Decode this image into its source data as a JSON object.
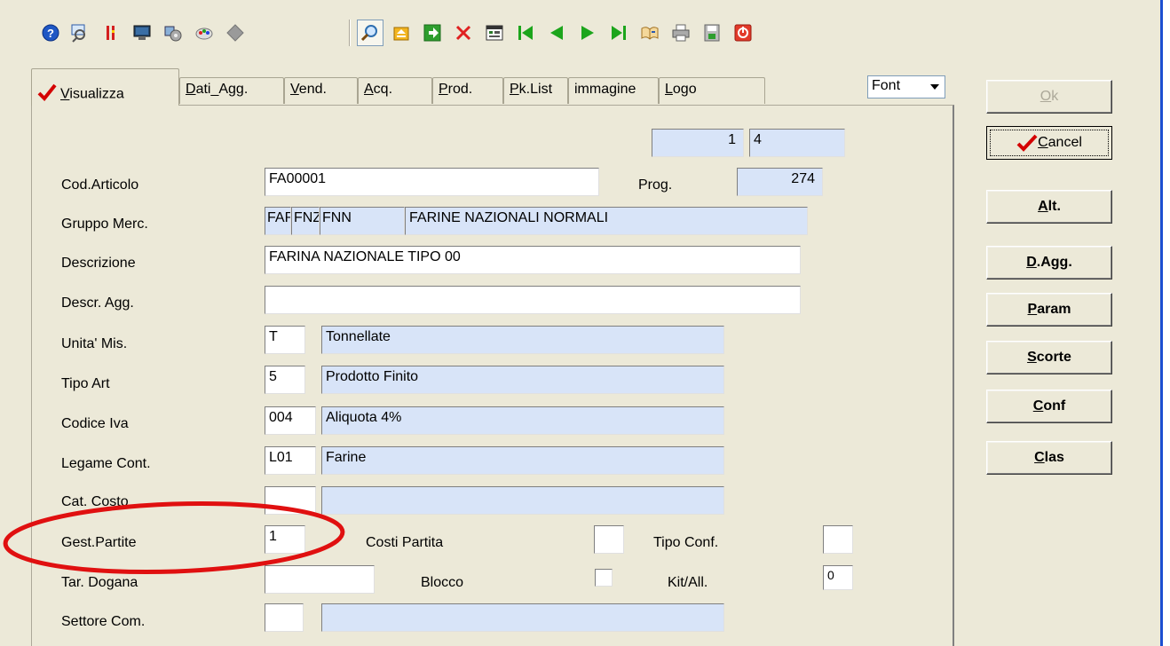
{
  "toolbar": {
    "buttons": [
      {
        "name": "help-icon"
      },
      {
        "name": "find-icon"
      },
      {
        "name": "red-bars-icon"
      },
      {
        "name": "monitor-icon"
      },
      {
        "name": "tools-icon"
      },
      {
        "name": "paint-icon"
      },
      {
        "name": "diamond-icon"
      },
      {
        "name": "search-icon"
      },
      {
        "name": "folder-up-icon"
      },
      {
        "name": "arrow-right-icon"
      },
      {
        "name": "delete-icon"
      },
      {
        "name": "calendar-icon"
      },
      {
        "name": "first-record-icon"
      },
      {
        "name": "prev-record-icon"
      },
      {
        "name": "next-record-icon"
      },
      {
        "name": "last-record-icon"
      },
      {
        "name": "book-icon"
      },
      {
        "name": "print-icon"
      },
      {
        "name": "save-icon"
      },
      {
        "name": "exit-icon"
      }
    ]
  },
  "tabs": [
    {
      "label": "Visualizza",
      "u": "V",
      "rest": "isualizza"
    },
    {
      "label": "Dati_Agg.",
      "u": "D",
      "rest": "ati_Agg."
    },
    {
      "label": "Vend.",
      "u": "V",
      "rest": "end."
    },
    {
      "label": "Acq.",
      "u": "A",
      "rest": "cq."
    },
    {
      "label": "Prod.",
      "u": "P",
      "rest": "rod."
    },
    {
      "label": "Pk.List",
      "u": "P",
      "rest": "k.List"
    },
    {
      "label": "immagine"
    },
    {
      "label": "Logo",
      "u": "L",
      "rest": "ogo"
    }
  ],
  "font_select": {
    "value": "Font"
  },
  "record": {
    "current": "1",
    "total": "4",
    "prog_label": "Prog.",
    "prog": "274"
  },
  "form": {
    "cod_articolo": {
      "label": "Cod.Articolo",
      "value": "FA00001"
    },
    "gruppo_merc": {
      "label": "Gruppo Merc.",
      "g1": "FAR",
      "g2": "FNZ",
      "g3": "FNN",
      "desc": "FARINE NAZIONALI NORMALI"
    },
    "descrizione": {
      "label": "Descrizione",
      "value": "FARINA NAZIONALE TIPO 00"
    },
    "descr_agg": {
      "label": "Descr. Agg.",
      "value": ""
    },
    "unita_mis": {
      "label": "Unita' Mis.",
      "code": "T",
      "desc": "Tonnellate"
    },
    "tipo_art": {
      "label": "Tipo  Art",
      "code": "5",
      "desc": "Prodotto Finito"
    },
    "codice_iva": {
      "label": "Codice Iva",
      "code": "004",
      "desc": "Aliquota 4%"
    },
    "legame_cont": {
      "label": "Legame Cont.",
      "code": "L01",
      "desc": "Farine"
    },
    "cat_costo": {
      "label": "Cat. Costo",
      "code": "",
      "desc": ""
    },
    "gest_partite": {
      "label": "Gest.Partite",
      "value": "1"
    },
    "costi_partita": {
      "label": "Costi Partita",
      "value": ""
    },
    "tipo_conf": {
      "label": "Tipo Conf.",
      "value": ""
    },
    "tar_dogana": {
      "label": "Tar. Dogana",
      "value": ""
    },
    "blocco": {
      "label": "Blocco",
      "checked": false
    },
    "kit_all": {
      "label": "Kit/All.",
      "value": "0"
    },
    "settore_com": {
      "label": "Settore Com.",
      "code": "",
      "desc": ""
    }
  },
  "side_buttons": {
    "ok": {
      "u": "O",
      "rest": "k"
    },
    "cancel": {
      "u": "C",
      "rest": "ancel"
    },
    "alt": {
      "u": "A",
      "rest": "lt."
    },
    "d_agg": {
      "u": "D",
      "rest": ".Agg."
    },
    "param": {
      "u": "P",
      "rest": "aram"
    },
    "scorte": {
      "u": "S",
      "rest": "corte"
    },
    "conf": {
      "u": "C",
      "rest": "onf"
    },
    "clas": {
      "u": "C",
      "rest": "las"
    }
  },
  "colors": {
    "readonly_bg": "#d8e4f8",
    "annotation": "#e01010",
    "accent": "#1c4fd1"
  }
}
